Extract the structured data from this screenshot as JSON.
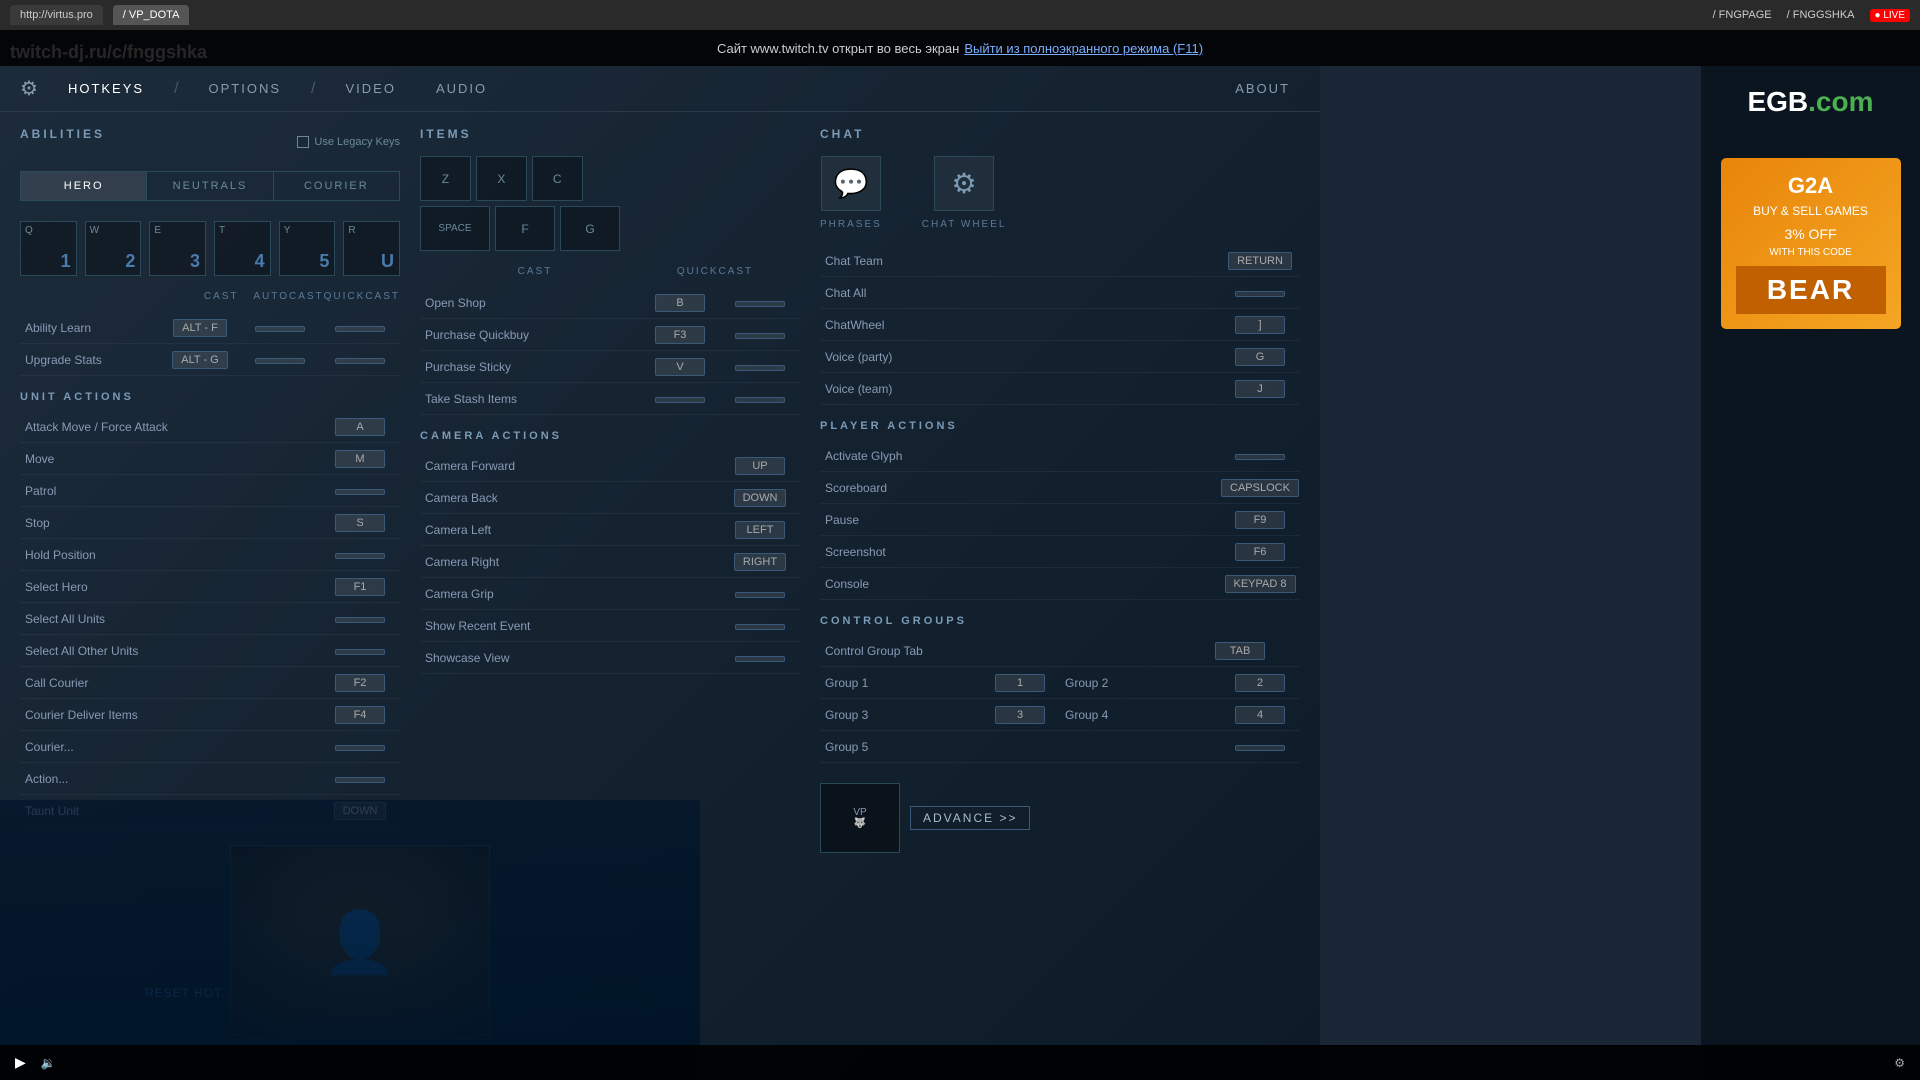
{
  "browser": {
    "tabs": [
      {
        "label": "http://virtus.pro",
        "active": false
      },
      {
        "label": "/ VP_DOTA",
        "active": false
      }
    ],
    "social": [
      {
        "label": "/ FNGPAGE"
      },
      {
        "label": "/ FNGGSHKA"
      },
      {
        "label": "● LIVE"
      }
    ],
    "twitch_url": "twitch-dj.ru/c/fnggshka"
  },
  "notification": {
    "text": "Сайт www.twitch.tv открыт во весь экран",
    "link": "Выйти из полноэкранного режима (F11)"
  },
  "nav": {
    "items": [
      "HOTKEYS",
      "/",
      "OPTIONS",
      "/",
      "VIDEO",
      "AUDIO",
      "ABOUT"
    ],
    "active": "HOTKEYS"
  },
  "abilities": {
    "title": "ABILITIES",
    "legacy_keys_label": "Use Legacy Keys",
    "tabs": [
      "HERO",
      "NEUTRALS",
      "COURIER"
    ],
    "active_tab": "HERO",
    "keys": [
      {
        "label": "Q",
        "num": "1"
      },
      {
        "label": "W",
        "num": "2"
      },
      {
        "label": "E",
        "num": "3"
      },
      {
        "label": "T",
        "num": "4"
      },
      {
        "label": "Y",
        "num": "5"
      },
      {
        "label": "R",
        "num": "U"
      }
    ],
    "columns": [
      "CAST",
      "AUTOCAST",
      "QUICKCAST"
    ],
    "bindings": [
      {
        "action": "Ability Learn",
        "cast": "ALT - F",
        "autocast": "",
        "quickcast": ""
      },
      {
        "action": "Upgrade Stats",
        "cast": "ALT - G",
        "autocast": "",
        "quickcast": ""
      }
    ]
  },
  "unit_actions": {
    "title": "UNIT ACTIONS",
    "bindings": [
      {
        "action": "Attack Move / Force Attack",
        "key": "A"
      },
      {
        "action": "Move",
        "key": "M"
      },
      {
        "action": "Patrol",
        "key": ""
      },
      {
        "action": "Stop",
        "key": "S"
      },
      {
        "action": "Hold Position",
        "key": ""
      },
      {
        "action": "Select Hero",
        "key": "F1"
      },
      {
        "action": "Select All Units",
        "key": ""
      },
      {
        "action": "Select All Other Units",
        "key": ""
      },
      {
        "action": "Call Courier",
        "key": "F2"
      },
      {
        "action": "Courier Deliver Items",
        "key": "F4"
      },
      {
        "action": "Courier...",
        "key": ""
      },
      {
        "action": "Action...",
        "key": ""
      },
      {
        "action": "Taunt Unit",
        "key": "DOWN"
      }
    ]
  },
  "items": {
    "title": "ITEMS",
    "row1": [
      "Z",
      "X",
      "C"
    ],
    "row2": [
      "SPACE",
      "F",
      "G"
    ],
    "columns": [
      "CAST",
      "QUICKCAST"
    ],
    "bindings": [
      {
        "action": "Open Shop",
        "cast": "B",
        "quickcast": ""
      },
      {
        "action": "Purchase Quickbuy",
        "cast": "F3",
        "quickcast": ""
      },
      {
        "action": "Purchase Sticky",
        "cast": "V",
        "quickcast": ""
      },
      {
        "action": "Take Stash Items",
        "cast": "",
        "quickcast": ""
      }
    ]
  },
  "camera_actions": {
    "title": "CAMERA ACTIONS",
    "bindings": [
      {
        "action": "Camera Forward",
        "key": "UP"
      },
      {
        "action": "Camera Back",
        "key": "DOWN"
      },
      {
        "action": "Camera Left",
        "key": "LEFT"
      },
      {
        "action": "Camera Right",
        "key": "RIGHT"
      },
      {
        "action": "Camera Grip",
        "key": ""
      },
      {
        "action": "Show Recent Event",
        "key": ""
      },
      {
        "action": "Showcase View",
        "key": ""
      }
    ]
  },
  "chat": {
    "title": "CHAT",
    "icons": [
      {
        "label": "PHRASES",
        "icon": "💬"
      },
      {
        "label": "CHAT WHEEL",
        "icon": "⚙"
      }
    ],
    "bindings": [
      {
        "action": "Chat Team",
        "key": "RETURN"
      },
      {
        "action": "Chat All",
        "key": ""
      },
      {
        "action": "ChatWheel",
        "key": "]"
      },
      {
        "action": "Voice (party)",
        "key": "G"
      },
      {
        "action": "Voice (team)",
        "key": "J"
      }
    ]
  },
  "player_actions": {
    "title": "PLAYER ACTIONS",
    "bindings": [
      {
        "action": "Activate Glyph",
        "key": ""
      },
      {
        "action": "Scoreboard",
        "key": "CAPSLOCK"
      },
      {
        "action": "Pause",
        "key": "F9"
      },
      {
        "action": "Screenshot",
        "key": "F6"
      },
      {
        "action": "Console",
        "key": "KEYPAD 8"
      }
    ]
  },
  "control_groups": {
    "title": "CONTROL GROUPS",
    "bindings": [
      {
        "action": "Control Group Tab",
        "key": "TAB"
      },
      {
        "action": "Group 1",
        "key": "1"
      },
      {
        "action": "Group 2",
        "key": "2"
      },
      {
        "action": "Group 3",
        "key": "3"
      },
      {
        "action": "Group 4",
        "key": "4"
      },
      {
        "action": "Group 5",
        "key": ""
      }
    ],
    "advance_label": "ADVANCE",
    "arrows": ">>"
  },
  "reset_button": "RESET HOT...",
  "egb": {
    "logo": "EGB.com",
    "g2a_title": "G2A",
    "g2a_subtitle": "BUY & SELL GAMES",
    "discount": "3% OFF\nWITH THIS CODE",
    "code": "BEAR"
  },
  "player": {
    "play_icon": "▶",
    "volume_icon": "🔉"
  }
}
